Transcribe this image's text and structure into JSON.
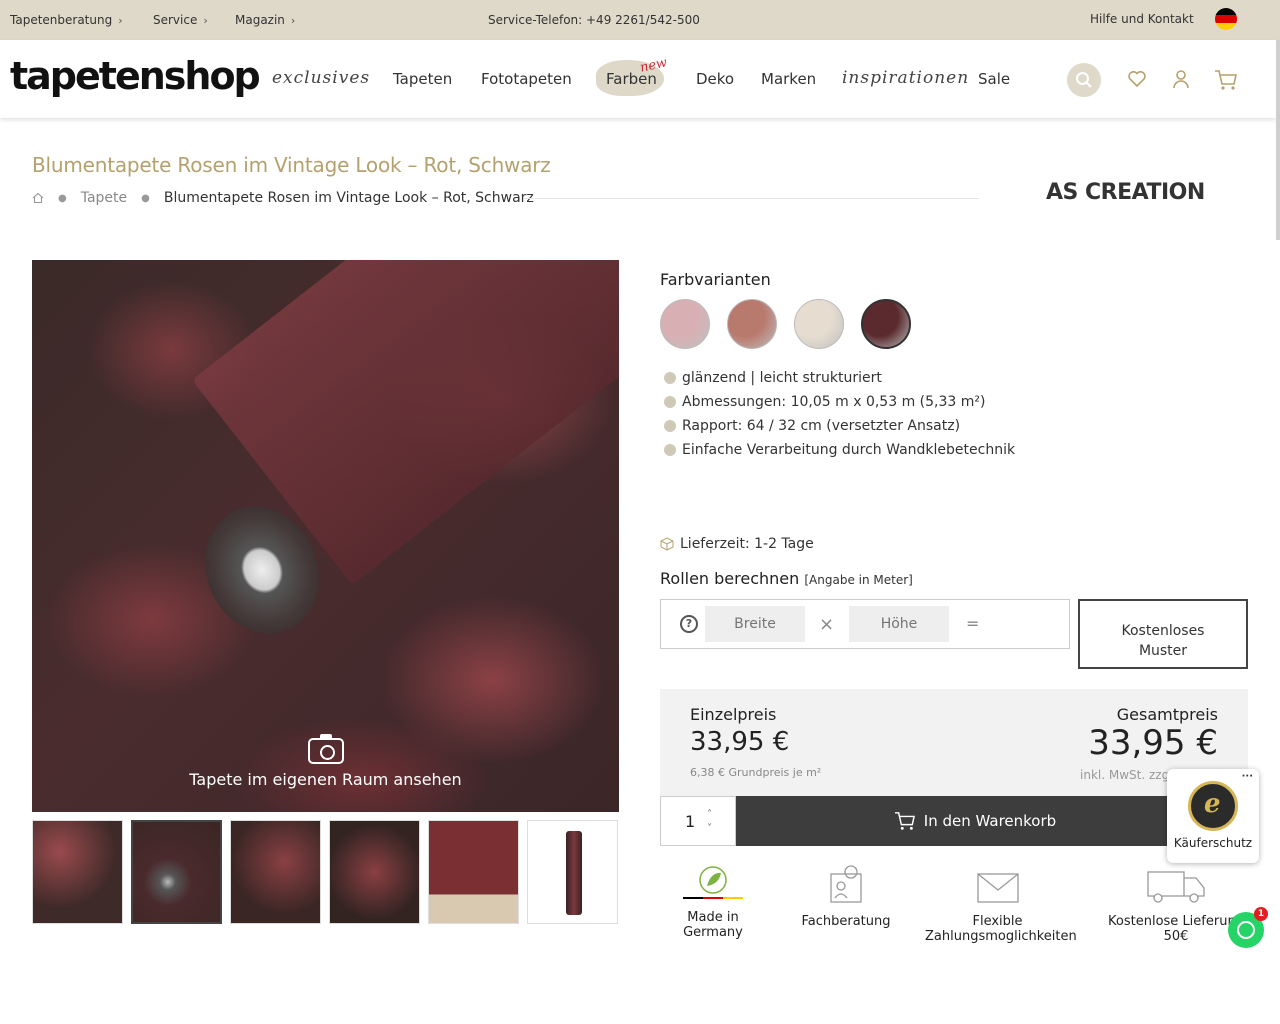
{
  "topbar": {
    "links": [
      {
        "label": "Tapetenberatung"
      },
      {
        "label": "Service"
      },
      {
        "label": "Magazin"
      }
    ],
    "phone": "Service-Telefon: +49 2261/542-500",
    "help": "Hilfe und Kontakt"
  },
  "header": {
    "logo": "tapetenshop",
    "nav": {
      "exclusives": "exclusives",
      "tapeten": "Tapeten",
      "fototapeten": "Fototapeten",
      "farben": "Farben",
      "farben_badge": "new",
      "deko": "Deko",
      "marken": "Marken",
      "inspirationen": "inspirationen",
      "sale": "Sale"
    },
    "icons": [
      "search-icon",
      "heart-icon",
      "user-icon",
      "cart-icon"
    ]
  },
  "product": {
    "title": "Blumentapete Rosen im Vintage Look – Rot, Schwarz",
    "breadcrumb": {
      "category": "Tapete",
      "current": "Blumentapete Rosen im Vintage Look – Rot, Schwarz"
    },
    "brand": "AS CREATION",
    "view_in_room": "Tapete im eigenen Raum ansehen",
    "farbvarianten_title": "Farbvarianten",
    "swatch_colors": [
      "#d8b0b4",
      "#b97a6e",
      "#e6ddd0",
      "#5a2a2e"
    ],
    "features": [
      "glänzend | leicht strukturiert",
      "Abmessungen: 10,05 m x 0,53 m (5,33 m²)",
      "Rapport: 64 / 32 cm (versetzter Ansatz)",
      "Einfache Verarbeitung durch Wandklebetechnik"
    ],
    "lieferzeit": "Lieferzeit: 1-2 Tage",
    "rollen_title": "Rollen berechnen",
    "rollen_hint": "[Angabe in Meter]",
    "calc": {
      "breite_placeholder": "Breite",
      "hoehe_placeholder": "Höhe",
      "question": "?",
      "times": "×",
      "equals": "="
    },
    "muster_label_line1": "Kostenloses",
    "muster_label_line2": "Muster",
    "einzelpreis_label": "Einzelpreis",
    "einzelpreis_value": "33,95 €",
    "grundpreis": "6,38 € Grundpreis je m²",
    "gesamtpreis_label": "Gesamtpreis",
    "gesamtpreis_value": "33,95 €",
    "tax_note": "inkl. MwSt. zzgl.",
    "quantity": "1",
    "cart_button": "In den Warenkorb"
  },
  "usps": [
    {
      "label": "Made in Germany"
    },
    {
      "label": "Fachberatung"
    },
    {
      "label_line1": "Flexible",
      "label_line2": "Zahlungsmoglichkeiten"
    },
    {
      "label_line1": "Kostenlose Lieferung",
      "label_line2": "50€"
    }
  ],
  "trusted": {
    "label": "Käuferschutz",
    "seal_letter": "e",
    "menu": "···"
  },
  "whatsapp_badge": "1"
}
